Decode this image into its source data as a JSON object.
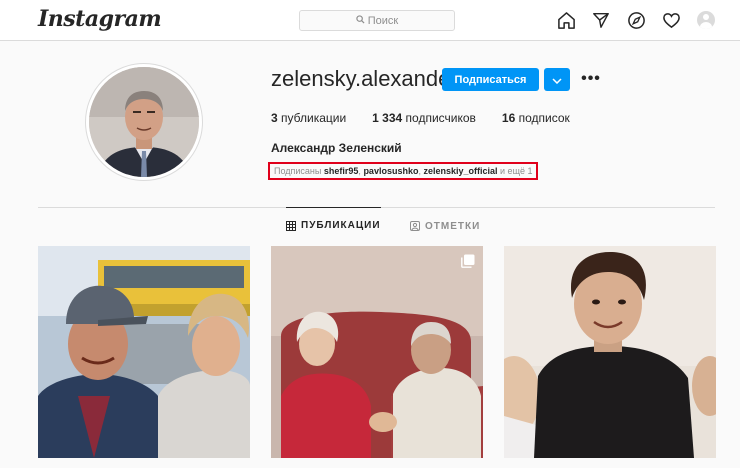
{
  "nav": {
    "logo": "Instagram",
    "search_placeholder": "Поиск",
    "icons": [
      "home-icon",
      "direct-icon",
      "explore-icon",
      "heart-icon",
      "profile-avatar-icon"
    ]
  },
  "profile": {
    "username": "zelensky.alexander",
    "follow_label": "Подписаться",
    "more_label": "•••",
    "stats": {
      "posts_count": "3",
      "posts_label": "публикации",
      "followers_count": "1 334",
      "followers_label": "подписчиков",
      "following_count": "16",
      "following_label": "подписок"
    },
    "full_name": "Александр Зеленский",
    "followed_by": {
      "prefix": "Подписаны",
      "users": [
        "shefir95",
        "pavlosushko",
        "zelenskiy_official"
      ],
      "suffix": "и ещё 1"
    }
  },
  "tabs": [
    {
      "label": "ПУБЛИКАЦИИ",
      "icon": "grid-icon",
      "active": true
    },
    {
      "label": "ОТМЕТКИ",
      "icon": "tagged-icon",
      "active": false
    }
  ],
  "colors": {
    "accent": "#0095f6",
    "highlight_border": "#e0001b",
    "muted_text": "#8e8e8e",
    "border": "#dbdbdb"
  },
  "posts": [
    {
      "description": "man-in-cap-and-woman-outdoors-photo"
    },
    {
      "description": "elderly-couple-on-sofa-photo",
      "multi": true
    },
    {
      "description": "young-man-portrait-photo"
    }
  ]
}
